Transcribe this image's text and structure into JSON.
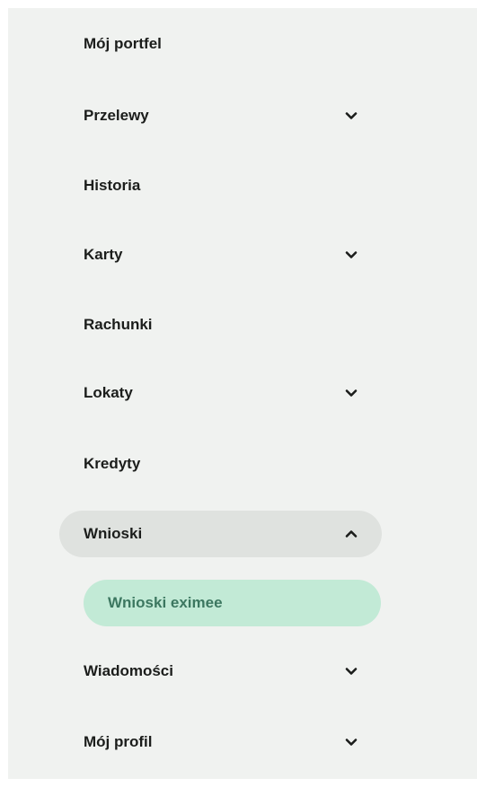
{
  "colors": {
    "panel_bg": "#f0f2f0",
    "expanded_bg": "#dfe2df",
    "active_sub_bg": "#c2ead6",
    "active_sub_text": "#3c7760",
    "text": "#1b1d1b"
  },
  "nav": {
    "items": [
      {
        "label": "Mój portfel",
        "chevron": "none"
      },
      {
        "label": "Przelewy",
        "chevron": "down"
      },
      {
        "label": "Historia",
        "chevron": "none"
      },
      {
        "label": "Karty",
        "chevron": "down"
      },
      {
        "label": "Rachunki",
        "chevron": "none"
      },
      {
        "label": "Lokaty",
        "chevron": "down"
      },
      {
        "label": "Kredyty",
        "chevron": "none"
      },
      {
        "label": "Wnioski",
        "chevron": "up",
        "expanded": true,
        "subitems": [
          {
            "label": "Wnioski eximee",
            "active": true
          }
        ]
      },
      {
        "label": "Wiadomości",
        "chevron": "down"
      },
      {
        "label": "Mój profil",
        "chevron": "down"
      }
    ]
  }
}
